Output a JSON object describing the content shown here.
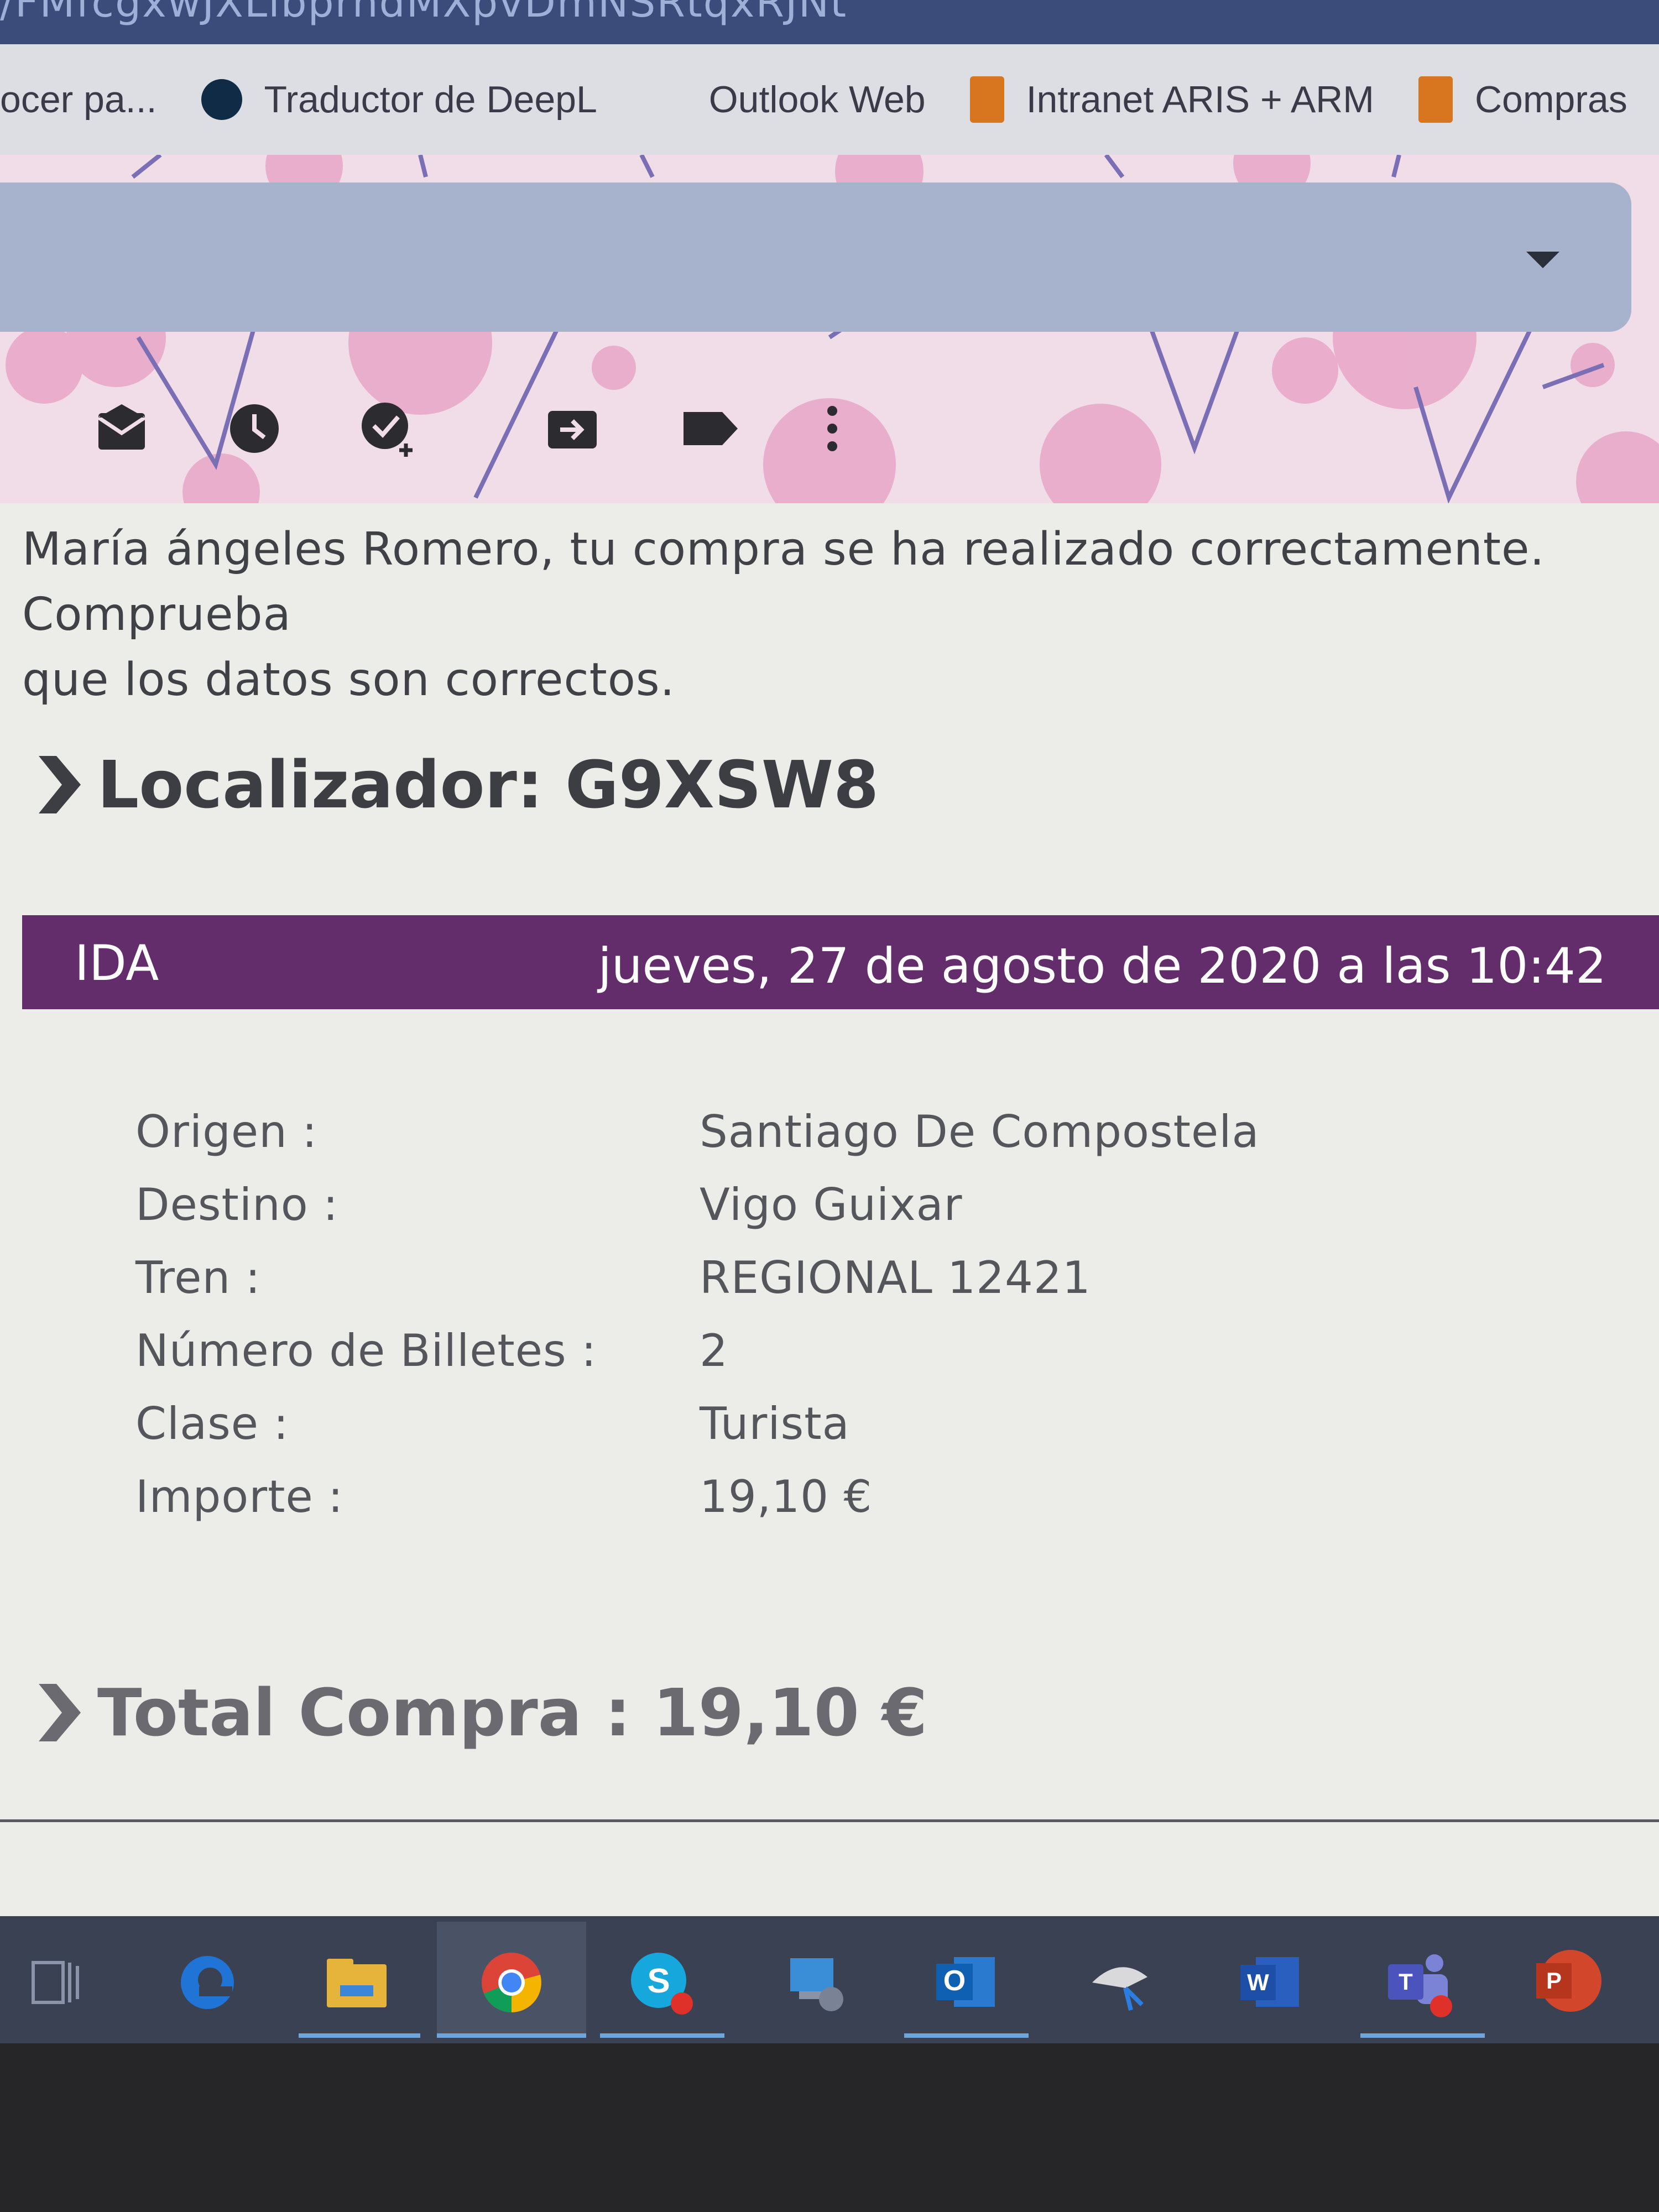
{
  "browser": {
    "url_fragment": "/FMfcgxwJXLlbprndMXpvDmNSRtqxRJNt",
    "bookmarks": [
      {
        "label": "ocer pa...",
        "icon": "none"
      },
      {
        "label": "Traductor de DeepL",
        "icon": "deepl-icon"
      },
      {
        "label": "Outlook Web",
        "icon": "outlook-grid-icon"
      },
      {
        "label": "Intranet ARIS + ARM",
        "icon": "bookmark-folder-icon"
      },
      {
        "label": "Compras",
        "icon": "bookmark-folder-icon"
      }
    ]
  },
  "mail": {
    "toolbar_icons": [
      "mark-unread-icon",
      "snooze-icon",
      "add-task-icon",
      "move-to-icon",
      "label-icon",
      "more-options-icon"
    ],
    "intro_line1": "María ángeles Romero, tu compra se ha realizado correctamente. Comprueba",
    "intro_line2": "que los datos son correctos.",
    "locator_label": "Localizador:",
    "locator_value": "G9XSW8",
    "trip": {
      "direction": "IDA",
      "datetime": "jueves, 27 de agosto de 2020 a las 10:42",
      "rows": [
        {
          "key": "Origen :",
          "value": "Santiago De Compostela"
        },
        {
          "key": "Destino :",
          "value": "Vigo Guixar"
        },
        {
          "key": "Tren :",
          "value": "REGIONAL 12421"
        },
        {
          "key": "Número de Billetes :",
          "value": "2"
        },
        {
          "key": "Clase :",
          "value": "Turista"
        },
        {
          "key": "Importe :",
          "value": "19,10 €"
        }
      ]
    },
    "total_label": "Total Compra :",
    "total_value": "19,10 €"
  },
  "taskbar": {
    "apps": [
      "task-view-icon",
      "edge-icon",
      "file-explorer-icon",
      "chrome-icon",
      "skype-icon",
      "remote-desktop-icon",
      "outlook-icon",
      "snipping-icon",
      "word-icon",
      "teams-icon",
      "powerpoint-icon"
    ],
    "letters": {
      "outlook": "O",
      "word": "W",
      "teams": "T",
      "powerpoint": "P"
    },
    "accent": "#632c6a"
  }
}
